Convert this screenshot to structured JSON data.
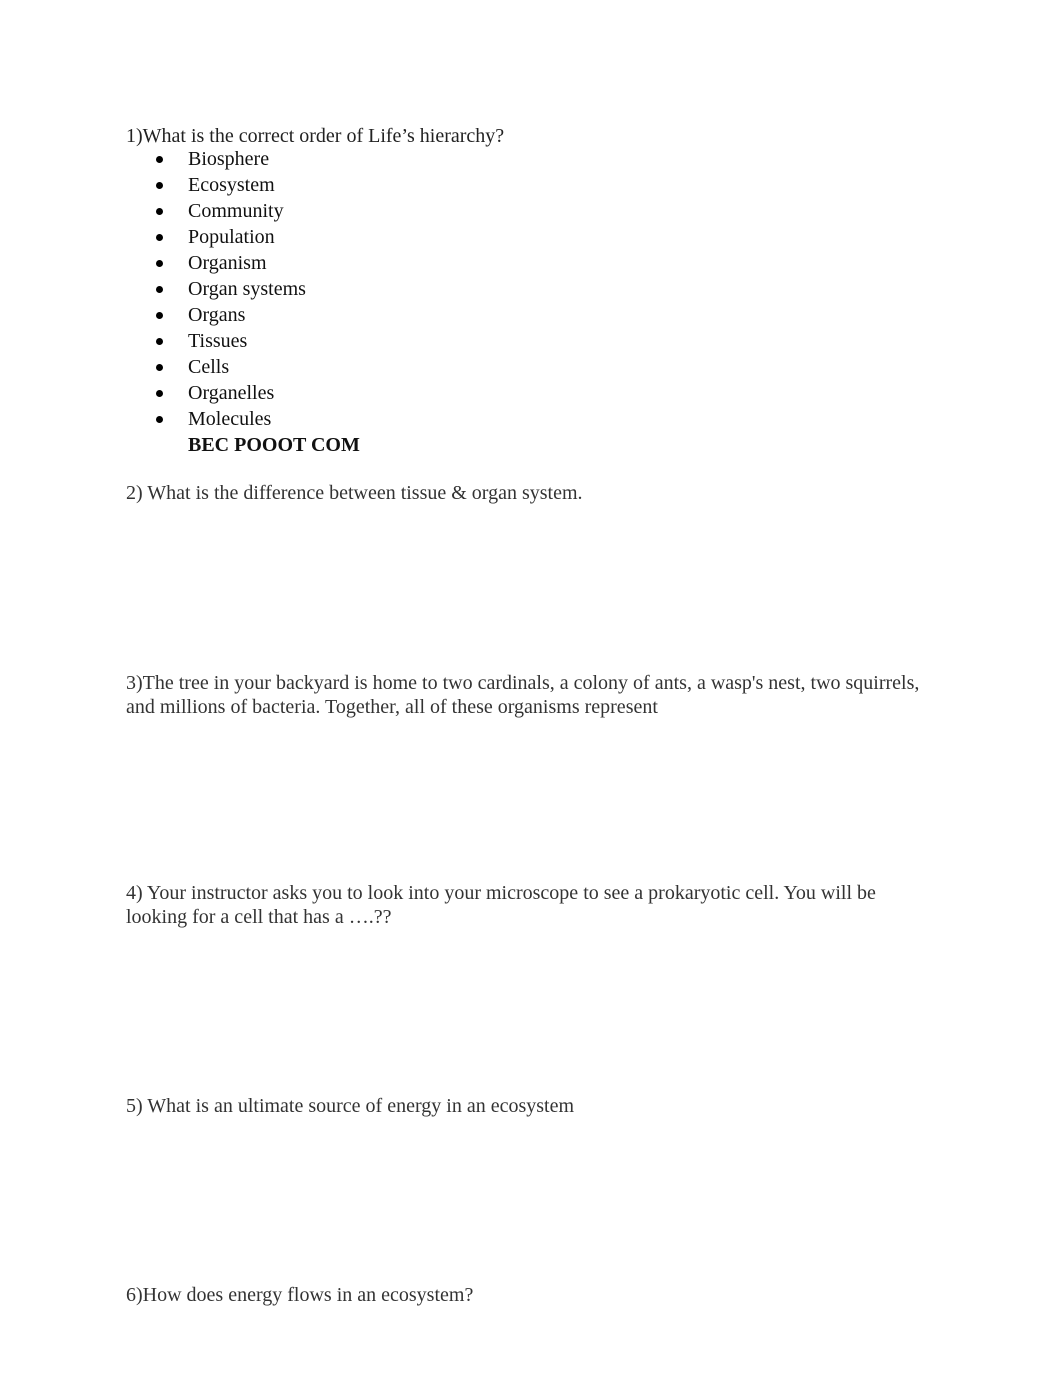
{
  "document": {
    "questions": [
      {
        "number": "1)",
        "text": "1)What is the correct order of Life’s hierarchy?",
        "list": [
          "Biosphere",
          "Ecosystem",
          "Community",
          "Population",
          "Organism",
          "Organ systems",
          "Organs",
          "Tissues",
          "Cells",
          "Organelles",
          "Molecules"
        ],
        "answer": "BEC POOOT COM"
      },
      {
        "number": "2)",
        "text": "2) What is the difference between tissue & organ system."
      },
      {
        "number": "3)",
        "text": "3)The tree in your backyard is home to two cardinals, a colony of ants, a wasp's nest, two squirrels, and millions of bacteria. Together, all of these organisms represent"
      },
      {
        "number": "4)",
        "text": "4) Your instructor asks you to look into your microscope to see a prokaryotic cell. You will be looking for a cell that has a ….??"
      },
      {
        "number": "5)",
        "text": "5) What is an ultimate source of energy in an ecosystem"
      },
      {
        "number": "6)",
        "text": "6)How does energy flows in an ecosystem?"
      }
    ]
  }
}
